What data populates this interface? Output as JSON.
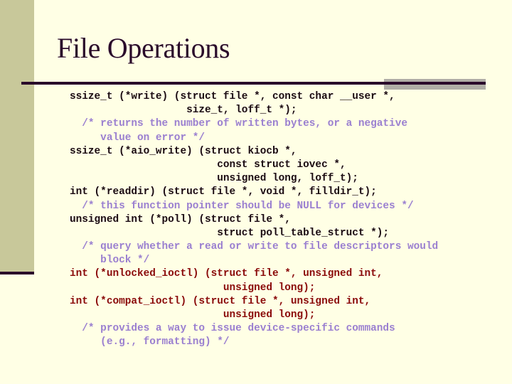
{
  "slide": {
    "title": "File Operations",
    "colors": {
      "background": "#ffffe5",
      "sidebar": "#c8c89a",
      "accent_dark": "#2a0a2a",
      "code": "#1a0a12",
      "comment": "#9a7fd0",
      "highlight": "#8a0a0a"
    },
    "code_lines": [
      {
        "text": "ssize_t (*write) (struct file *, const char __user *,",
        "style": "normal"
      },
      {
        "text": "                   size_t, loff_t *);",
        "style": "normal"
      },
      {
        "text": "  /* returns the number of written bytes, or a negative",
        "style": "comment"
      },
      {
        "text": "     value on error */",
        "style": "comment"
      },
      {
        "text": "ssize_t (*aio_write) (struct kiocb *,",
        "style": "normal"
      },
      {
        "text": "                        const struct iovec *,",
        "style": "normal"
      },
      {
        "text": "                        unsigned long, loff_t);",
        "style": "normal"
      },
      {
        "text": "int (*readdir) (struct file *, void *, filldir_t);",
        "style": "normal"
      },
      {
        "text": "  /* this function pointer should be NULL for devices */",
        "style": "comment"
      },
      {
        "text": "unsigned int (*poll) (struct file *,",
        "style": "normal"
      },
      {
        "text": "                        struct poll_table_struct *);",
        "style": "normal"
      },
      {
        "text": "  /* query whether a read or write to file descriptors would",
        "style": "comment"
      },
      {
        "text": "     block */",
        "style": "comment"
      },
      {
        "text": "int (*unlocked_ioctl) (struct file *, unsigned int,",
        "style": "red"
      },
      {
        "text": "                         unsigned long);",
        "style": "red"
      },
      {
        "text": "int (*compat_ioctl) (struct file *, unsigned int,",
        "style": "red"
      },
      {
        "text": "                         unsigned long);",
        "style": "red"
      },
      {
        "text": "  /* provides a way to issue device-specific commands",
        "style": "comment"
      },
      {
        "text": "     (e.g., formatting) */",
        "style": "comment"
      }
    ]
  }
}
